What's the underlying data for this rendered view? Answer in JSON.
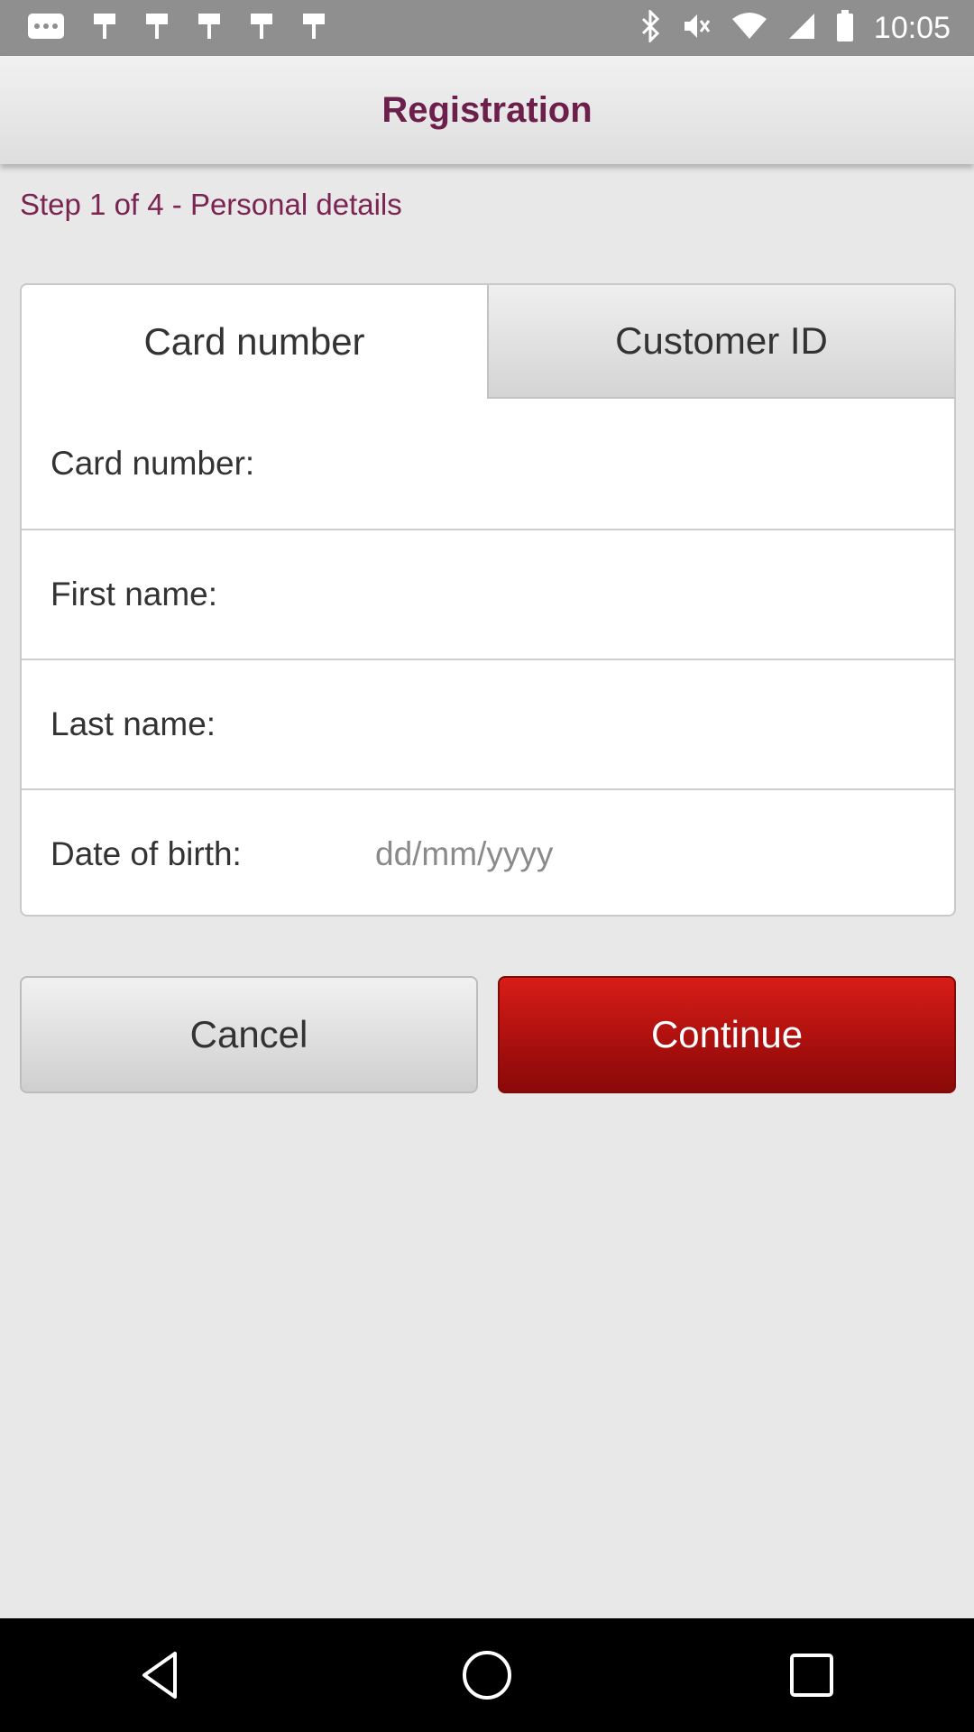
{
  "status_bar": {
    "time": "10:05",
    "left_icons": [
      "more-icon",
      "notification-icon",
      "notification-icon",
      "notification-icon",
      "notification-icon",
      "notification-icon"
    ],
    "right_icons": [
      "bluetooth-icon",
      "mute-icon",
      "wifi-icon",
      "signal-icon",
      "battery-icon"
    ]
  },
  "header": {
    "title": "Registration"
  },
  "step_label": "Step 1 of 4 - Personal details",
  "tabs": [
    {
      "label": "Card number",
      "active": true
    },
    {
      "label": "Customer ID",
      "active": false
    }
  ],
  "fields": {
    "card_number": {
      "label": "Card number:",
      "value": ""
    },
    "first_name": {
      "label": "First name:",
      "value": ""
    },
    "last_name": {
      "label": "Last name:",
      "value": ""
    },
    "date_of_birth": {
      "label": "Date of birth:",
      "placeholder": "dd/mm/yyyy"
    }
  },
  "buttons": {
    "cancel": "Cancel",
    "continue": "Continue"
  },
  "colors": {
    "header_title": "#6d1f4c",
    "step_label": "#7a2452",
    "continue_bg": "#c0130f",
    "page_bg": "#e8e8e8"
  },
  "nav_bar": [
    "back-icon",
    "home-icon",
    "recents-icon"
  ]
}
